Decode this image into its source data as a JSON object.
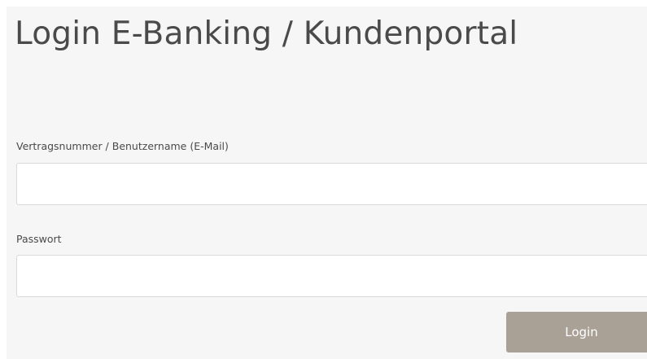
{
  "page": {
    "title": "Login E-Banking / Kundenportal"
  },
  "form": {
    "username_label": "Vertragsnummer / Benutzername (E-Mail)",
    "username_value": "",
    "username_placeholder": "",
    "password_label": "Passwort",
    "password_value": "",
    "password_placeholder": "",
    "submit_label": "Login"
  },
  "colors": {
    "panel_background": "#f6f6f6",
    "title_text": "#4a4a4a",
    "button_background": "#aaa196",
    "button_text": "#ffffff"
  }
}
